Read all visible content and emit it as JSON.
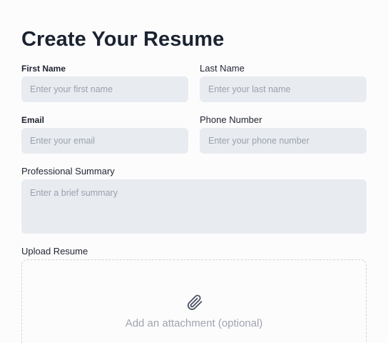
{
  "form": {
    "title": "Create Your Resume",
    "first_name": {
      "label": "First Name",
      "placeholder": "Enter your first name",
      "value": ""
    },
    "last_name": {
      "label": "Last Name",
      "placeholder": "Enter your last name",
      "value": ""
    },
    "email": {
      "label": "Email",
      "placeholder": "Enter your email",
      "value": ""
    },
    "phone": {
      "label": "Phone Number",
      "placeholder": "Enter your phone number",
      "value": ""
    },
    "summary": {
      "label": "Professional Summary",
      "placeholder": "Enter a brief summary",
      "value": ""
    },
    "upload": {
      "label": "Upload Resume",
      "hint": "Add an attachment (optional)",
      "icon": "paperclip-icon"
    }
  },
  "colors": {
    "background": "#fcfcfd",
    "input_bg": "#e8ebf0",
    "text": "#1f2430",
    "placeholder": "#9aa1ad",
    "dashed_border": "#cfd4dc"
  }
}
